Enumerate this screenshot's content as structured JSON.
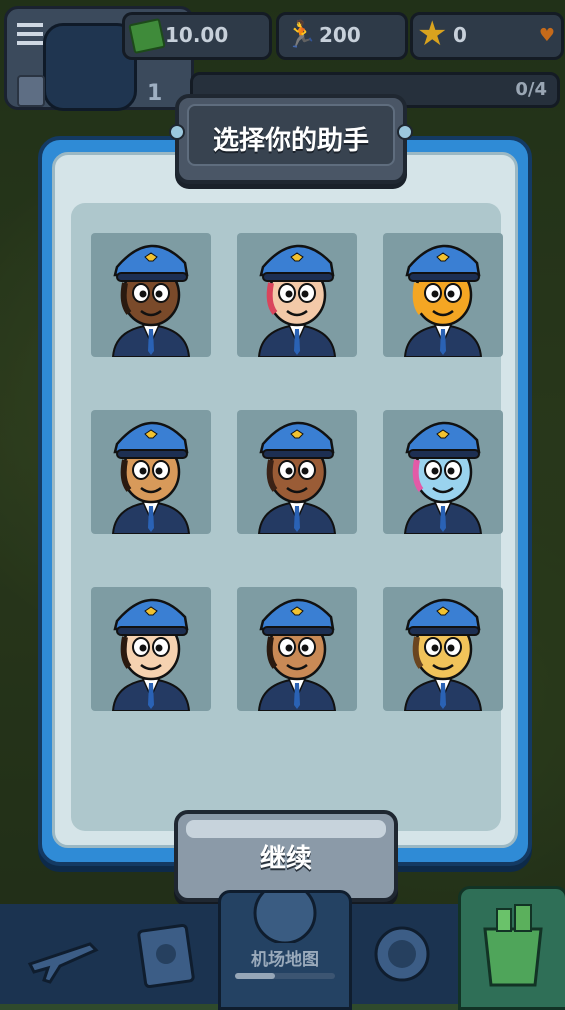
{
  "hud": {
    "cash_value": "10.00",
    "passengers_value": "200",
    "stars_value": "0",
    "level": "1",
    "progress_text": "0/4",
    "icons": [
      "menu-icon",
      "passport-icon",
      "cash-icon",
      "passenger-icon",
      "star-icon",
      "heart-icon"
    ]
  },
  "dialog": {
    "title": "选择你的助手",
    "continue_label": "继续",
    "assistants": [
      {
        "id": "pilot-man",
        "skin": "#7a4a2a",
        "hair": "#2a1a10"
      },
      {
        "id": "pilot-woman-pink",
        "skin": "#f3c9a8",
        "hair": "#d9455c"
      },
      {
        "id": "pilot-tiger",
        "skin": "#f4a623",
        "hair": "#f4a623"
      },
      {
        "id": "pilot-man-2",
        "skin": "#d89a5a",
        "hair": "#2a1a10"
      },
      {
        "id": "pilot-woman-curly",
        "skin": "#9a5c36",
        "hair": "#3b2216"
      },
      {
        "id": "pilot-unicorn",
        "skin": "#9ad3ee",
        "hair": "#e35aa7"
      },
      {
        "id": "pilot-boy",
        "skin": "#f5d2b0",
        "hair": "#2a1a10"
      },
      {
        "id": "pilot-woman-long",
        "skin": "#c98a56",
        "hair": "#2a1a10"
      },
      {
        "id": "pilot-dog",
        "skin": "#f1c35a",
        "hair": "#6a4520"
      }
    ]
  },
  "bottom_nav": {
    "map_label": "机场地图",
    "map_progress": 0.4,
    "icons": [
      "plane-icon",
      "photo-icon",
      "map-icon",
      "compass-icon",
      "shop-icon"
    ]
  },
  "colors": {
    "dialog_border": "#2f8bd6",
    "tile_bg": "#7e9ca3",
    "cap": "#3a7fd3"
  }
}
